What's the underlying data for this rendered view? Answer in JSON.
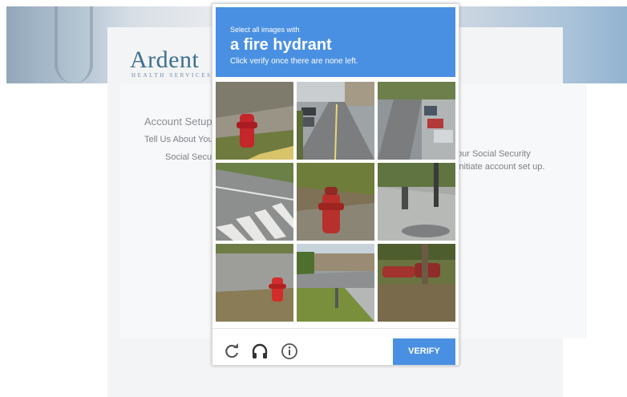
{
  "background": {
    "logo": {
      "name": "Ardent",
      "subtitle": "HEALTH SERVICES"
    },
    "texts": {
      "account_setup": "Account Setup",
      "tell_us": "Tell Us About You",
      "social_security": "Social Security",
      "right_line1": "our Social Security",
      "right_line2": "initiate account set up."
    }
  },
  "captcha": {
    "header": {
      "instruction": "Select all images with",
      "target": "a fire hydrant",
      "hint": "Click verify once there are none left."
    },
    "tiles": [
      {
        "scene": "road-with-hydrant"
      },
      {
        "scene": "street-parked-cars"
      },
      {
        "scene": "street-parked-cars-right"
      },
      {
        "scene": "crosswalk"
      },
      {
        "scene": "hydrant-closeup"
      },
      {
        "scene": "sidewalk-pole"
      },
      {
        "scene": "curb-with-hydrant"
      },
      {
        "scene": "houses-road"
      },
      {
        "scene": "red-car-trees"
      }
    ],
    "footer": {
      "reload_icon": "reload-icon",
      "audio_icon": "headphones-icon",
      "info_icon": "info-icon",
      "verify_label": "VERIFY"
    },
    "colors": {
      "accent": "#4a90e2"
    }
  }
}
